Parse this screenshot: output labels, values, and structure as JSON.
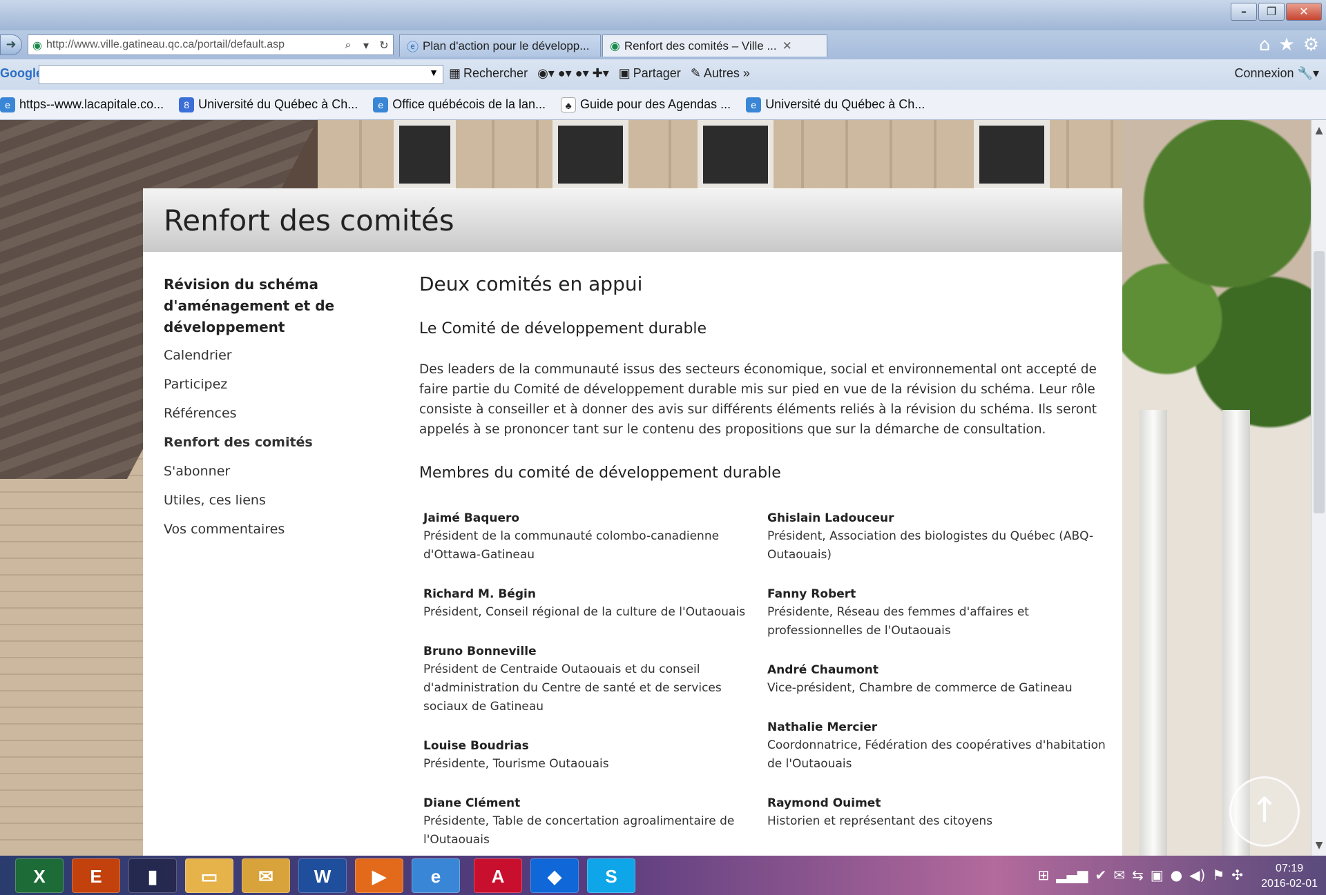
{
  "browser": {
    "address_url": "http://www.ville.gatineau.qc.ca/portail/default.asp",
    "tabs": [
      {
        "label": "Plan d'action pour le développ..."
      },
      {
        "label": "Renfort des comités – Ville ..."
      }
    ],
    "google_label": "Google",
    "google_items": [
      "Rechercher",
      "Partager",
      "Autres »"
    ],
    "connexion": "Connexion",
    "favorites": [
      "https--www.lacapitale.co...",
      "Université du Québec à Ch...",
      "Office québécois de la lan...",
      "Guide pour des Agendas ...",
      "Université du Québec à Ch..."
    ]
  },
  "page": {
    "title": "Renfort des comités",
    "sidenav": {
      "head": "Révision du schéma d'aménagement et de développement",
      "items": [
        "Calendrier",
        "Participez",
        "Références",
        "Renfort des comités",
        "S'abonner",
        "Utiles, ces liens",
        "Vos commentaires"
      ]
    },
    "heading": "Deux comités en appui",
    "subheading": "Le Comité de développement durable",
    "intro": "Des leaders de la communauté issus des secteurs économique, social et environnemental ont accepté de faire partie du Comité de développement durable mis sur pied en vue de la révision du schéma. Leur rôle consiste à conseiller et à donner des avis sur différents éléments reliés à la révision du schéma. Ils seront appelés à se prononcer tant sur le contenu des propositions que sur la démarche de consultation.",
    "members_heading": "Membres du comité de développement durable",
    "members_left": [
      {
        "name": "Jaimé Baquero",
        "role": "Président de la communauté colombo-canadienne d'Ottawa-Gatineau"
      },
      {
        "name": "Richard M. Bégin",
        "role": "Président, Conseil régional de la culture de l'Outaouais"
      },
      {
        "name": "Bruno Bonneville",
        "role": "Président de Centraide Outaouais et du conseil d'administration du Centre de santé et de services sociaux de Gatineau"
      },
      {
        "name": "Louise Boudrias",
        "role": "Présidente, Tourisme Outaouais"
      },
      {
        "name": "Diane Clément",
        "role": "Présidente, Table de concertation agroalimentaire de l'Outaouais"
      }
    ],
    "members_right": [
      {
        "name": "Ghislain Ladouceur",
        "role": "Président, Association des biologistes du Québec (ABQ-Outaouais)"
      },
      {
        "name": "Fanny Robert",
        "role": "Présidente, Réseau des femmes d'affaires et professionnelles de l'Outaouais"
      },
      {
        "name": "André Chaumont",
        "role": "Vice-président, Chambre de commerce de Gatineau"
      },
      {
        "name": "Nathalie Mercier",
        "role": "Coordonnatrice, Fédération des coopératives d'habitation de l'Outaouais"
      },
      {
        "name": "Raymond Ouimet",
        "role": "Historien et représentant des citoyens"
      }
    ]
  },
  "taskbar": {
    "time": "07:19",
    "date": "2016-02-01"
  }
}
